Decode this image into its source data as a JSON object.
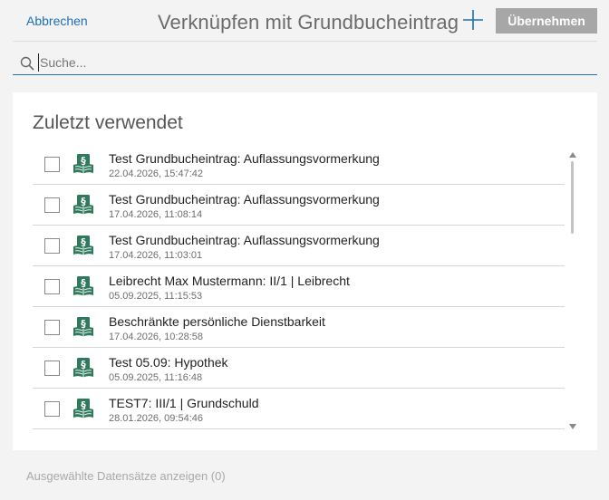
{
  "header": {
    "cancel_label": "Abbrechen",
    "title": "Verknüpfen mit Grundbucheintrag",
    "add_icon": "plus-icon",
    "apply_label": "Übernehmen"
  },
  "search": {
    "placeholder": "Suche...",
    "value": ""
  },
  "recent": {
    "title": "Zuletzt verwendet",
    "items": [
      {
        "name": "Test Grundbucheintrag: Auflassungsvormerkung",
        "date": "22.04.2026, 15:47:42",
        "checked": false
      },
      {
        "name": "Test Grundbucheintrag: Auflassungsvormerkung",
        "date": "17.04.2026, 11:08:14",
        "checked": false
      },
      {
        "name": "Test Grundbucheintrag: Auflassungsvormerkung",
        "date": "17.04.2026, 11:03:01",
        "checked": false
      },
      {
        "name": "Leibrecht Max Mustermann: II/1 | Leibrecht",
        "date": "05.09.2025, 11:15:53",
        "checked": false
      },
      {
        "name": "Beschränkte persönliche Dienstbarkeit",
        "date": "17.04.2026, 10:28:58",
        "checked": false
      },
      {
        "name": "Test 05.09: Hypothek",
        "date": "05.09.2025, 11:16:48",
        "checked": false
      },
      {
        "name": "TEST7: III/1 | Grundschuld",
        "date": "28.01.2026, 09:54:46",
        "checked": false
      }
    ]
  },
  "footer": {
    "show_selected_label": "Ausgewählte Datensätze anzeigen (0)"
  },
  "colors": {
    "accent": "#1e6fb8",
    "icon_green": "#2f7a5c",
    "button_disabled": "#a7a7a7"
  }
}
